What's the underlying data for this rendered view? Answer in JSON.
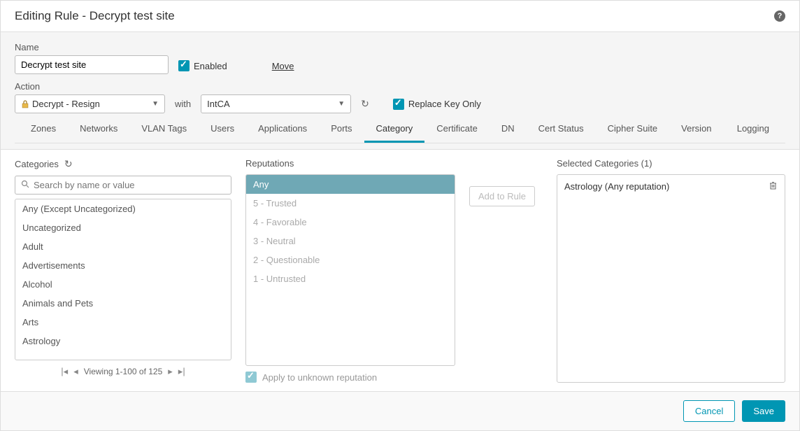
{
  "header": {
    "title": "Editing Rule - Decrypt test site"
  },
  "form": {
    "name_label": "Name",
    "name_value": "Decrypt test site",
    "enabled_label": "Enabled",
    "move_label": "Move",
    "action_label": "Action",
    "action_value": "Decrypt - Resign",
    "with_text": "with",
    "ca_value": "IntCA",
    "replace_key_label": "Replace Key Only"
  },
  "tabs": [
    "Zones",
    "Networks",
    "VLAN Tags",
    "Users",
    "Applications",
    "Ports",
    "Category",
    "Certificate",
    "DN",
    "Cert Status",
    "Cipher Suite",
    "Version",
    "Logging"
  ],
  "active_tab": "Category",
  "categories": {
    "label": "Categories",
    "search_placeholder": "Search by name or value",
    "items": [
      "Any (Except Uncategorized)",
      "Uncategorized",
      "Adult",
      "Advertisements",
      "Alcohol",
      "Animals and Pets",
      "Arts",
      "Astrology"
    ],
    "pager_text": "Viewing 1-100 of 125"
  },
  "reputations": {
    "label": "Reputations",
    "items": [
      {
        "text": "Any",
        "selected": true
      },
      {
        "text": "5 - Trusted",
        "selected": false
      },
      {
        "text": "4 - Favorable",
        "selected": false
      },
      {
        "text": "3 - Neutral",
        "selected": false
      },
      {
        "text": "2 - Questionable",
        "selected": false
      },
      {
        "text": "1 - Untrusted",
        "selected": false
      }
    ],
    "apply_unknown_label": "Apply to unknown reputation",
    "add_to_rule_label": "Add to Rule"
  },
  "selected": {
    "label": "Selected Categories (1)",
    "items": [
      "Astrology (Any reputation)"
    ]
  },
  "footer": {
    "cancel": "Cancel",
    "save": "Save"
  }
}
